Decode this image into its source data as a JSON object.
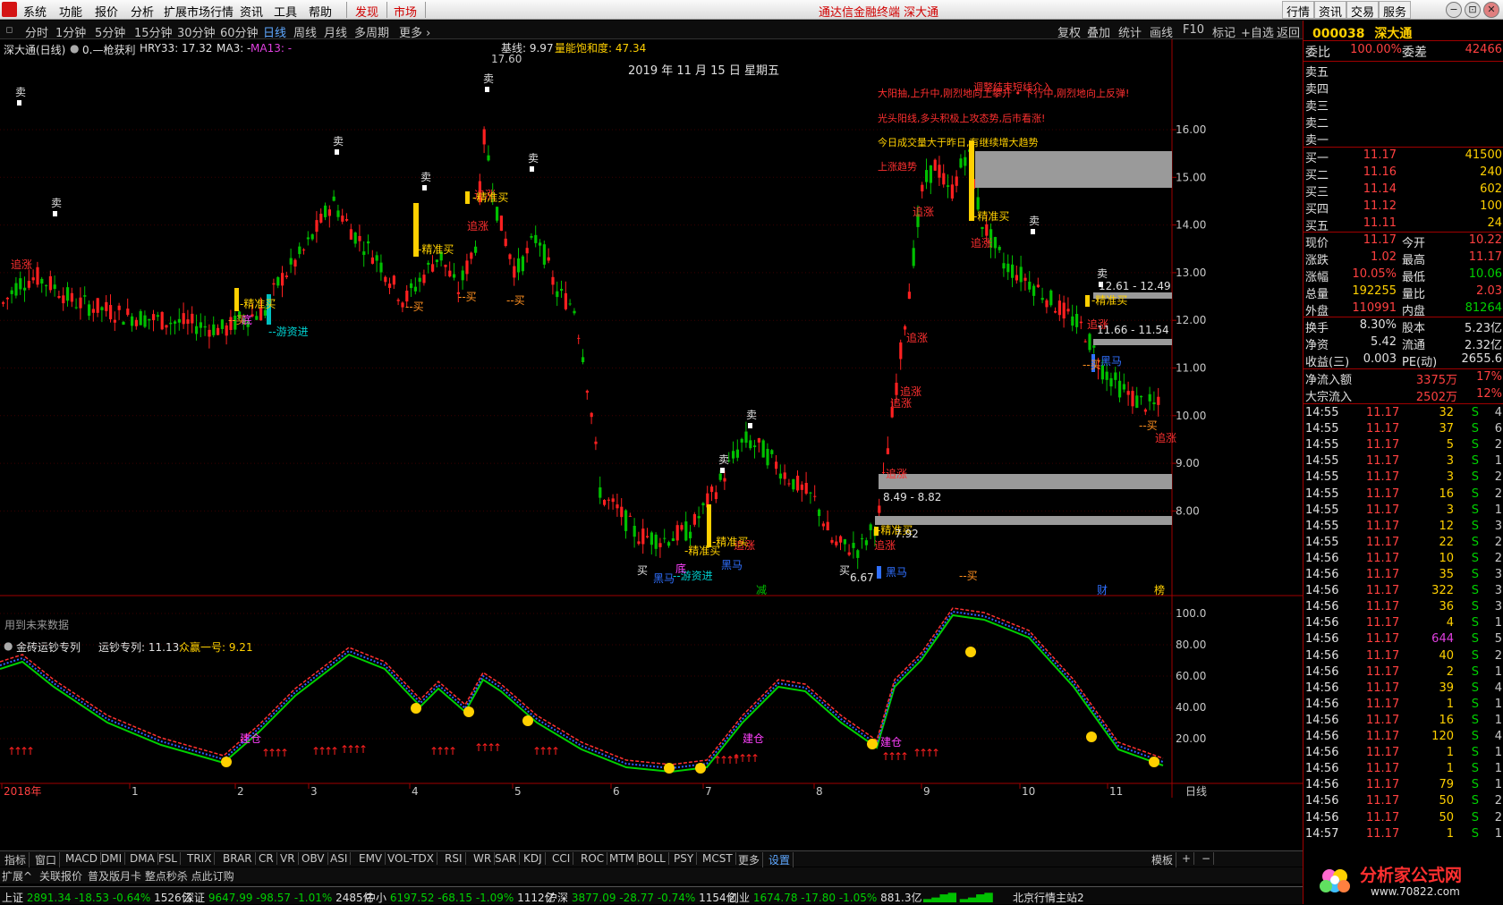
{
  "menubar": {
    "items": [
      "系统",
      "功能",
      "报价",
      "分析",
      "扩展市场行情",
      "资讯",
      "工具",
      "帮助"
    ],
    "special": [
      "发现",
      "市场"
    ],
    "center_title": "通达信金融终端  深大通",
    "right_buttons": [
      "行情",
      "资讯",
      "交易",
      "服务"
    ],
    "window_buttons": [
      "−",
      "⊡",
      "✕"
    ]
  },
  "toolbar": {
    "periods": [
      "分时",
      "1分钟",
      "5分钟",
      "15分钟",
      "30分钟",
      "60分钟",
      "日线",
      "周线",
      "月线",
      "多周期",
      "更多 ›"
    ],
    "active_period": "日线",
    "right_items": [
      "复权",
      "叠加",
      "统计",
      "画线",
      "F10",
      "标记",
      "+自选",
      "返回"
    ]
  },
  "main_chart": {
    "header_left": "深大通(日线)",
    "header_indicator": "0.—枪获利",
    "hry": "HRY33: 17.32",
    "ma3": "MA3: -",
    "ma13": "MA13: -",
    "jixian": "基线: 9.97",
    "liangneng": "量能饱和度: 47.34",
    "date_label": "2019 年 11 月 15 日 星期五",
    "peak_label": "17.60",
    "future_note": "用到未来数据",
    "price_axis": [
      "16.00",
      "15.00",
      "14.00",
      "13.00",
      "12.00",
      "11.00",
      "10.00",
      "9.00",
      "8.00"
    ],
    "red_notes": [
      "调整结束短线介入",
      "大阳抽,上升中,刚烈地向上攀升 • 下行中,刚烈地向上反弹!",
      "光头阳线,多头积极上攻态势,后市看涨!",
      "今日成交量大于昨日,有继续增大趋势",
      "上涨趋势"
    ],
    "range_labels": [
      "12.61 - 12.49",
      "11.66 - 11.54",
      "8.49 - 8.82",
      "7.92",
      "6.67"
    ],
    "signal_labels": {
      "sell": "卖",
      "chase": "追涨",
      "precise_buy": "精准买",
      "buy": "--买",
      "buy_short": "买",
      "swim_in": "--游资进",
      "dark_horse": "黑马",
      "bottom": "底",
      "reduce": "减",
      "caifu": "财",
      "bang": "榜",
      "jiancang": "建仓"
    }
  },
  "sub_chart": {
    "title": "金砖运钞专列",
    "line1": "运钞专列: 11.13",
    "line2": "众赢一号: 9.21",
    "axis": [
      "100.0",
      "80.00",
      "60.00",
      "40.00",
      "20.00"
    ]
  },
  "date_axis": [
    "2018年",
    "1",
    "2",
    "3",
    "4",
    "5",
    "6",
    "7",
    "8",
    "9",
    "10",
    "11"
  ],
  "date_axis_right": "日线",
  "bottom_tabs": [
    "指标",
    "窗口",
    "MACD",
    "DMI",
    "DMA",
    "FSL",
    "TRIX",
    "BRAR",
    "CR",
    "VR",
    "OBV",
    "ASI",
    "EMV",
    "VOL-TDX",
    "RSI",
    "WR",
    "SAR",
    "KDJ",
    "CCI",
    "ROC",
    "MTM",
    "BOLL",
    "PSY",
    "MCST",
    "更多",
    "设置"
  ],
  "bottom_tabs_right": [
    "模板",
    "+",
    "−"
  ],
  "bottom_tabs2": [
    "扩展^",
    "关联报价",
    "普及版月卡 整点秒杀 点此订购"
  ],
  "statusbar": [
    {
      "name": "上证",
      "value": "2891.34",
      "chg": "-18.53",
      "pct": "-0.64%",
      "amt": "1526亿"
    },
    {
      "name": "深证",
      "value": "9647.99",
      "chg": "-98.57",
      "pct": "-1.01%",
      "amt": "2485亿"
    },
    {
      "name": "中小",
      "value": "6197.52",
      "chg": "-68.15",
      "pct": "-1.09%",
      "amt": "1112亿"
    },
    {
      "name": "沪深",
      "value": "3877.09",
      "chg": "-28.77",
      "pct": "-0.74%",
      "amt": "1154亿"
    },
    {
      "name": "创业",
      "value": "1674.78",
      "chg": "-17.80",
      "pct": "-1.05%",
      "amt": "881.3亿"
    }
  ],
  "status_right": "北京行情主站2",
  "quote_panel": {
    "code": "000038",
    "name": "深大通",
    "weibi_label": "委比",
    "weibi": "100.00%",
    "weicha_label": "委差",
    "weicha": "42466",
    "sells": [
      {
        "label": "卖五",
        "price": "",
        "vol": ""
      },
      {
        "label": "卖四",
        "price": "",
        "vol": ""
      },
      {
        "label": "卖三",
        "price": "",
        "vol": ""
      },
      {
        "label": "卖二",
        "price": "",
        "vol": ""
      },
      {
        "label": "卖一",
        "price": "",
        "vol": ""
      }
    ],
    "buys": [
      {
        "label": "买一",
        "price": "11.17",
        "vol": "41500"
      },
      {
        "label": "买二",
        "price": "11.16",
        "vol": "240"
      },
      {
        "label": "买三",
        "price": "11.14",
        "vol": "602"
      },
      {
        "label": "买四",
        "price": "11.12",
        "vol": "100"
      },
      {
        "label": "买五",
        "price": "11.11",
        "vol": "24"
      }
    ],
    "stats": [
      {
        "l1": "现价",
        "v1": "11.17",
        "l2": "今开",
        "v2": "10.22",
        "c1": "#ff4040",
        "c2": "#ff4040"
      },
      {
        "l1": "涨跌",
        "v1": "1.02",
        "l2": "最高",
        "v2": "11.17",
        "c1": "#ff4040",
        "c2": "#ff4040"
      },
      {
        "l1": "涨幅",
        "v1": "10.05%",
        "l2": "最低",
        "v2": "10.06",
        "c1": "#ff4040",
        "c2": "#00d000"
      },
      {
        "l1": "总量",
        "v1": "192255",
        "l2": "量比",
        "v2": "2.03",
        "c1": "#ffd000",
        "c2": "#ff4040"
      },
      {
        "l1": "外盘",
        "v1": "110991",
        "l2": "内盘",
        "v2": "81264",
        "c1": "#ff4040",
        "c2": "#00d000"
      }
    ],
    "stats2": [
      {
        "l1": "换手",
        "v1": "8.30%",
        "l2": "股本",
        "v2": "5.23亿"
      },
      {
        "l1": "净资",
        "v1": "5.42",
        "l2": "流通",
        "v2": "2.32亿"
      },
      {
        "l1": "收益(三)",
        "v1": "0.003",
        "l2": "PE(动)",
        "v2": "2655.6"
      }
    ],
    "flows": [
      {
        "label": "净流入额",
        "value": "3375万",
        "pct": "17%"
      },
      {
        "label": "大宗流入",
        "value": "2502万",
        "pct": "12%"
      }
    ],
    "ticks": [
      {
        "t": "14:55",
        "p": "11.17",
        "v": "32",
        "s": "S",
        "n": "4"
      },
      {
        "t": "14:55",
        "p": "11.17",
        "v": "37",
        "s": "S",
        "n": "6"
      },
      {
        "t": "14:55",
        "p": "11.17",
        "v": "5",
        "s": "S",
        "n": "2"
      },
      {
        "t": "14:55",
        "p": "11.17",
        "v": "3",
        "s": "S",
        "n": "1"
      },
      {
        "t": "14:55",
        "p": "11.17",
        "v": "3",
        "s": "S",
        "n": "2"
      },
      {
        "t": "14:55",
        "p": "11.17",
        "v": "16",
        "s": "S",
        "n": "2"
      },
      {
        "t": "14:55",
        "p": "11.17",
        "v": "3",
        "s": "S",
        "n": "1"
      },
      {
        "t": "14:55",
        "p": "11.17",
        "v": "12",
        "s": "S",
        "n": "3"
      },
      {
        "t": "14:55",
        "p": "11.17",
        "v": "22",
        "s": "S",
        "n": "2"
      },
      {
        "t": "14:56",
        "p": "11.17",
        "v": "10",
        "s": "S",
        "n": "2"
      },
      {
        "t": "14:56",
        "p": "11.17",
        "v": "35",
        "s": "S",
        "n": "3"
      },
      {
        "t": "14:56",
        "p": "11.17",
        "v": "322",
        "s": "S",
        "n": "3"
      },
      {
        "t": "14:56",
        "p": "11.17",
        "v": "36",
        "s": "S",
        "n": "3"
      },
      {
        "t": "14:56",
        "p": "11.17",
        "v": "4",
        "s": "S",
        "n": "1"
      },
      {
        "t": "14:56",
        "p": "11.17",
        "v": "644",
        "s": "S",
        "n": "5"
      },
      {
        "t": "14:56",
        "p": "11.17",
        "v": "40",
        "s": "S",
        "n": "2"
      },
      {
        "t": "14:56",
        "p": "11.17",
        "v": "2",
        "s": "S",
        "n": "1"
      },
      {
        "t": "14:56",
        "p": "11.17",
        "v": "39",
        "s": "S",
        "n": "4"
      },
      {
        "t": "14:56",
        "p": "11.17",
        "v": "1",
        "s": "S",
        "n": "1"
      },
      {
        "t": "14:56",
        "p": "11.17",
        "v": "16",
        "s": "S",
        "n": "1"
      },
      {
        "t": "14:56",
        "p": "11.17",
        "v": "120",
        "s": "S",
        "n": "4"
      },
      {
        "t": "14:56",
        "p": "11.17",
        "v": "1",
        "s": "S",
        "n": "1"
      },
      {
        "t": "14:56",
        "p": "11.17",
        "v": "1",
        "s": "S",
        "n": "1"
      },
      {
        "t": "14:56",
        "p": "11.17",
        "v": "79",
        "s": "S",
        "n": "1"
      },
      {
        "t": "14:56",
        "p": "11.17",
        "v": "50",
        "s": "S",
        "n": "2"
      },
      {
        "t": "14:56",
        "p": "11.17",
        "v": "50",
        "s": "S",
        "n": "2"
      },
      {
        "t": "14:57",
        "p": "11.17",
        "v": "1",
        "s": "S",
        "n": "1"
      }
    ]
  },
  "watermark": {
    "line1": "分析家公式网",
    "line2": "www.70822.com"
  },
  "colors": {
    "up": "#ff3030",
    "down": "#00c000",
    "yellow": "#ffd000",
    "grid": "#8b0000"
  }
}
